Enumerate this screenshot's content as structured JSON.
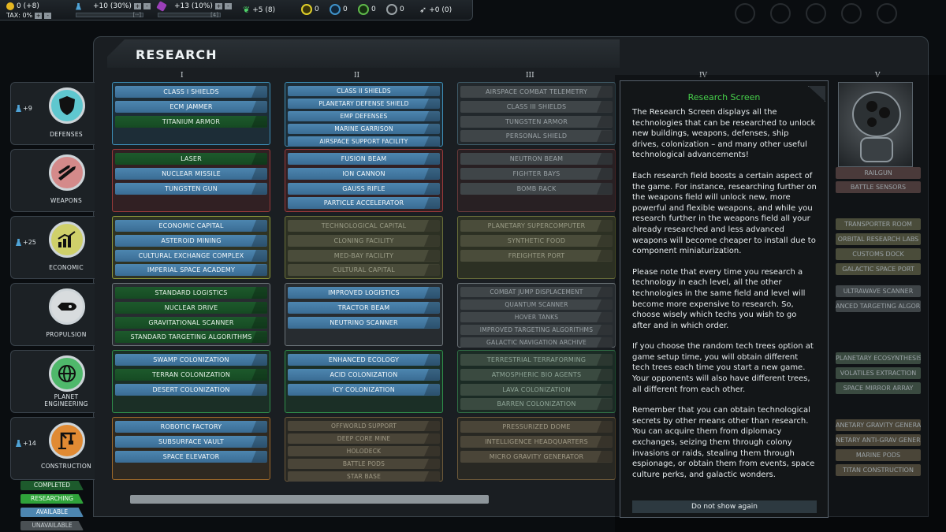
{
  "topbar": {
    "credits": "0 (+8)",
    "tax": "TAX: 0%",
    "research": "+10 (30%)",
    "research_bar": "[--]",
    "production": "+13 (10%)",
    "production_bar": "[4]",
    "food": "+5 (8)",
    "r1": "0",
    "r2": "0",
    "r3": "0",
    "r4": "0",
    "ships": "+0 (0)",
    "plus": "+",
    "minus": "-"
  },
  "panel": {
    "title": "RESEARCH"
  },
  "columns": [
    "I",
    "II",
    "III",
    "IV",
    "V"
  ],
  "categories": [
    {
      "label": "DEFENSES",
      "badge": "+9",
      "color": "#5fc7cf"
    },
    {
      "label": "WEAPONS",
      "badge": "",
      "color": "#d48a8a"
    },
    {
      "label": "ECONOMIC",
      "badge": "+25",
      "color": "#cfd06a"
    },
    {
      "label": "PROPULSION",
      "badge": "",
      "color": "#d8dcde"
    },
    {
      "label": "PLANET",
      "label2": "ENGINEERING",
      "badge": "",
      "color": "#4fb86b"
    },
    {
      "label": "CONSTRUCTION",
      "badge": "+14",
      "color": "#e08a33"
    }
  ],
  "tech": {
    "defenses": {
      "c1": [
        "CLASS I SHIELDS",
        "ECM JAMMER",
        "TITANIUM ARMOR"
      ],
      "c2": [
        "CLASS II SHIELDS",
        "PLANETARY DEFENSE SHIELD",
        "EMP DEFENSES",
        "MARINE GARRISON",
        "AIRSPACE SUPPORT FACILITY"
      ],
      "c3": [
        "AIRSPACE COMBAT TELEMETRY",
        "CLASS III SHIELDS",
        "TUNGSTEN ARMOR",
        "PERSONAL SHIELD"
      ]
    },
    "weapons": {
      "c1": [
        "LASER",
        "NUCLEAR MISSILE",
        "TUNGSTEN GUN"
      ],
      "c2": [
        "FUSION BEAM",
        "ION CANNON",
        "GAUSS RIFLE",
        "PARTICLE ACCELERATOR"
      ],
      "c3": [
        "NEUTRON BEAM",
        "FIGHTER BAYS",
        "BOMB RACK"
      ],
      "c5": [
        "RAILGUN",
        "BATTLE SENSORS"
      ]
    },
    "economic": {
      "c1": [
        "ECONOMIC CAPITAL",
        "ASTEROID MINING",
        "CULTURAL EXCHANGE COMPLEX",
        "IMPERIAL SPACE ACADEMY"
      ],
      "c2": [
        "TECHNOLOGICAL CAPITAL",
        "CLONING FACILITY",
        "MED-BAY FACILITY",
        "CULTURAL CAPITAL"
      ],
      "c3": [
        "PLANETARY SUPERCOMPUTER",
        "SYNTHETIC FOOD",
        "FREIGHTER PORT"
      ],
      "c5": [
        "TRANSPORTER ROOM",
        "ORBITAL RESEARCH LABS",
        "CUSTOMS DOCK",
        "GALACTIC SPACE PORT"
      ]
    },
    "propulsion": {
      "c1": [
        "STANDARD LOGISTICS",
        "NUCLEAR DRIVE",
        "GRAVITATIONAL SCANNER",
        "STANDARD TARGETING ALGORITHMS"
      ],
      "c2": [
        "IMPROVED LOGISTICS",
        "TRACTOR BEAM",
        "NEUTRINO SCANNER"
      ],
      "c3": [
        "COMBAT JUMP DISPLACEMENT",
        "QUANTUM SCANNER",
        "HOVER TANKS",
        "IMPROVED TARGETING ALGORITHMS",
        "GALACTIC NAVIGATION ARCHIVE"
      ],
      "c5": [
        "ULTRAWAVE SCANNER",
        "ANCED TARGETING ALGORI"
      ]
    },
    "planet": {
      "c1": [
        "SWAMP COLONIZATION",
        "TERRAN COLONIZATION",
        "DESERT COLONIZATION"
      ],
      "c2": [
        "ENHANCED ECOLOGY",
        "ACID COLONIZATION",
        "ICY COLONIZATION"
      ],
      "c3": [
        "TERRESTRIAL TERRAFORMING",
        "ATMOSPHERIC BIO AGENTS",
        "LAVA COLONIZATION",
        "BARREN COLONIZATION"
      ],
      "c5": [
        "PLANETARY ECOSYNTHESIS",
        "VOLATILES EXTRACTION",
        "SPACE MIRROR ARRAY"
      ]
    },
    "construction": {
      "c1": [
        "ROBOTIC FACTORY",
        "SUBSURFACE VAULT",
        "SPACE ELEVATOR"
      ],
      "c2": [
        "OFFWORLD SUPPORT",
        "DEEP CORE MINE",
        "HOLODECK",
        "BATTLE PODS",
        "STAR BASE"
      ],
      "c3": [
        "PRESSURIZED DOME",
        "INTELLIGENCE HEADQUARTERS",
        "MICRO GRAVITY GENERATOR"
      ],
      "c5": [
        "ANETARY GRAVITY GENERA",
        "NETARY ANTI-GRAV GENER",
        "MARINE PODS",
        "TITAN CONSTRUCTION"
      ]
    }
  },
  "legend": [
    "COMPLETED",
    "RESEARCHING",
    "AVAILABLE",
    "UNAVAILABLE"
  ],
  "dialog": {
    "title": "Research Screen",
    "p1": "The Research Screen displays all the technologies that can be researched to unlock new buildings, weapons, defenses, ship drives, colonization – and many other useful technological advancements!",
    "p2": "Each research field boosts a certain aspect of the game. For instance, researching further on the weapons field will unlock new, more powerful and flexible weapons, and while you research further in the weapons field all your already researched and less advanced weapons will become cheaper to install due to component miniaturization.",
    "p3": "Please note that every time you research a technology in each level, all the other technologies in the same field and level will become more expensive to research. So, choose wisely which techs you wish to go after and in which order.",
    "p4": "If you choose the random tech trees option at game setup time, you will obtain different tech trees each time you start a new game. Your opponents will also have different trees, all different from each other.",
    "p5": "Remember that you can obtain technological secrets by other means other than research. You can acquire them from diplomacy exchanges, seizing them through colony invasions or raids, stealing them through espionage, or obtain them from events, space culture perks, and galactic wonders.",
    "button": "Do not show again"
  }
}
